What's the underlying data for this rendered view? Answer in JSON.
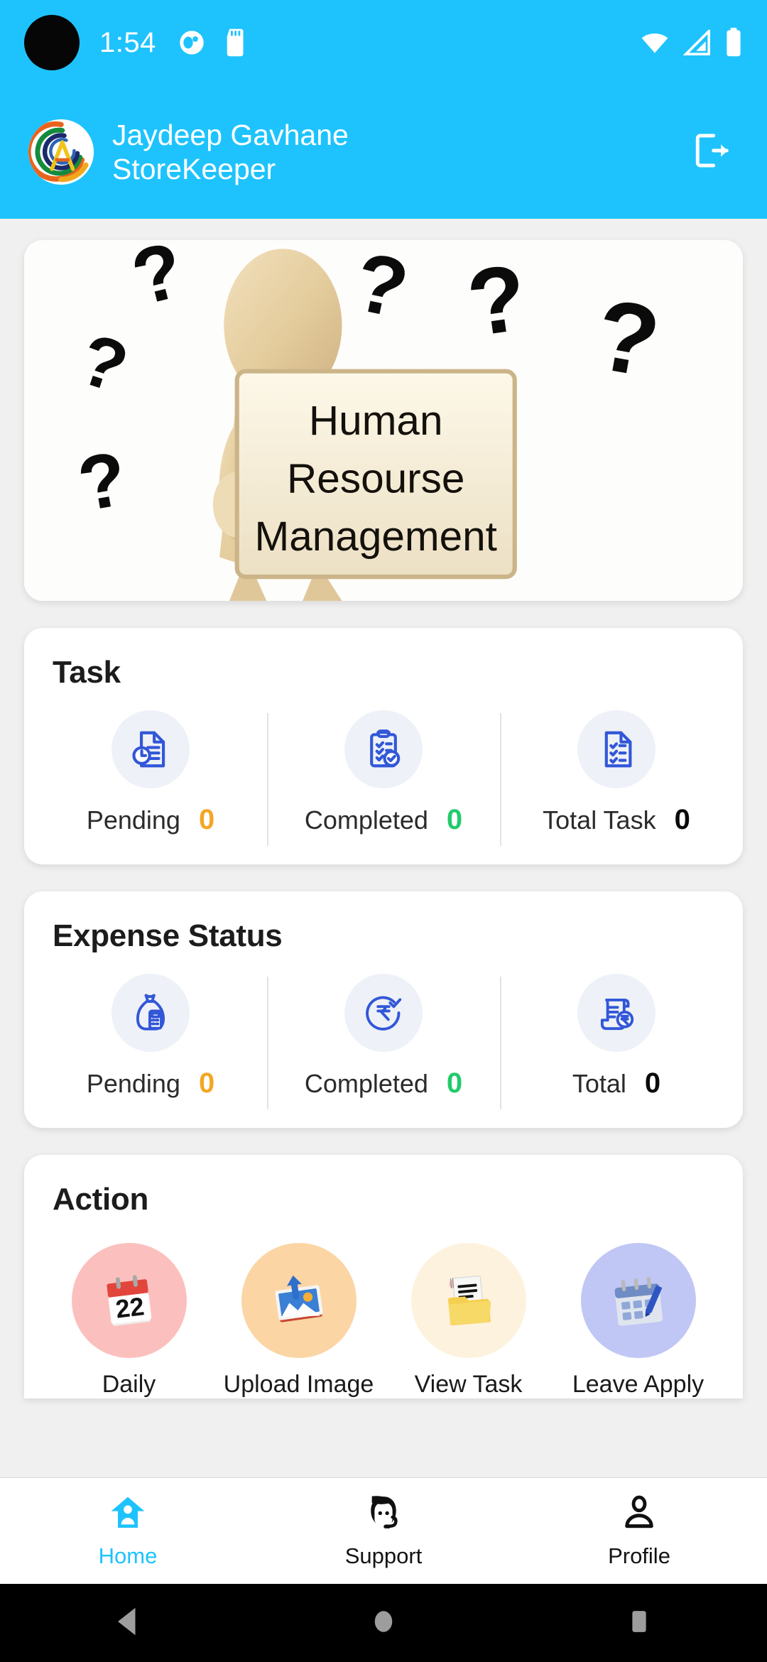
{
  "status_bar": {
    "time": "1:54",
    "icons": [
      "punch-hole-camera",
      "notification-circle-icon",
      "sd-card-icon",
      "wifi-icon",
      "cellular-signal-icon",
      "battery-icon"
    ]
  },
  "header": {
    "user_name": "Jaydeep Gavhane",
    "user_role": "StoreKeeper",
    "logo_alt": "app-logo",
    "logout_icon": "logout-icon",
    "background_color": "#1ec3fd"
  },
  "banner": {
    "sign_line1": "Human",
    "sign_line2": "Resourse",
    "sign_line3": "Management",
    "alt": "3d-figure-holding-sign-with-question-marks"
  },
  "task_card": {
    "title": "Task",
    "items": [
      {
        "label": "Pending",
        "value": "0",
        "color": "#f5a623",
        "icon": "document-clock-icon"
      },
      {
        "label": "Completed",
        "value": "0",
        "color": "#21cb6b",
        "icon": "clipboard-check-icon"
      },
      {
        "label": "Total Task",
        "value": "0",
        "color": "#0a0a0a",
        "icon": "document-checklist-icon"
      }
    ]
  },
  "expense_card": {
    "title": "Expense Status",
    "items": [
      {
        "label": "Pending",
        "value": "0",
        "color": "#f5a623",
        "icon": "money-bag-icon"
      },
      {
        "label": "Completed",
        "value": "0",
        "color": "#21cb6b",
        "icon": "rupee-check-circle-icon"
      },
      {
        "label": "Total",
        "value": "0",
        "color": "#0a0a0a",
        "icon": "rupee-receipt-icon"
      }
    ]
  },
  "action_card": {
    "title": "Action",
    "items": [
      {
        "label": "Daily",
        "icon": "calendar-22-icon",
        "bg": "#fbc0bd"
      },
      {
        "label": "Upload Image",
        "icon": "upload-image-icon",
        "bg": "#fbd5a4"
      },
      {
        "label": "View Task",
        "icon": "folder-document-icon",
        "bg": "#fdf2dd"
      },
      {
        "label": "Leave Apply",
        "icon": "calendar-pen-icon",
        "bg": "#c0c7f5"
      }
    ]
  },
  "bottom_nav": {
    "active_color": "#1ec3fd",
    "items": [
      {
        "label": "Home",
        "icon": "home-person-icon",
        "active": true
      },
      {
        "label": "Support",
        "icon": "headset-face-icon",
        "active": false
      },
      {
        "label": "Profile",
        "icon": "person-icon",
        "active": false
      }
    ]
  },
  "system_nav": {
    "items": [
      {
        "label": "Back",
        "icon": "back-triangle-icon"
      },
      {
        "label": "Home",
        "icon": "home-circle-icon"
      },
      {
        "label": "Recents",
        "icon": "recents-square-icon"
      }
    ]
  }
}
